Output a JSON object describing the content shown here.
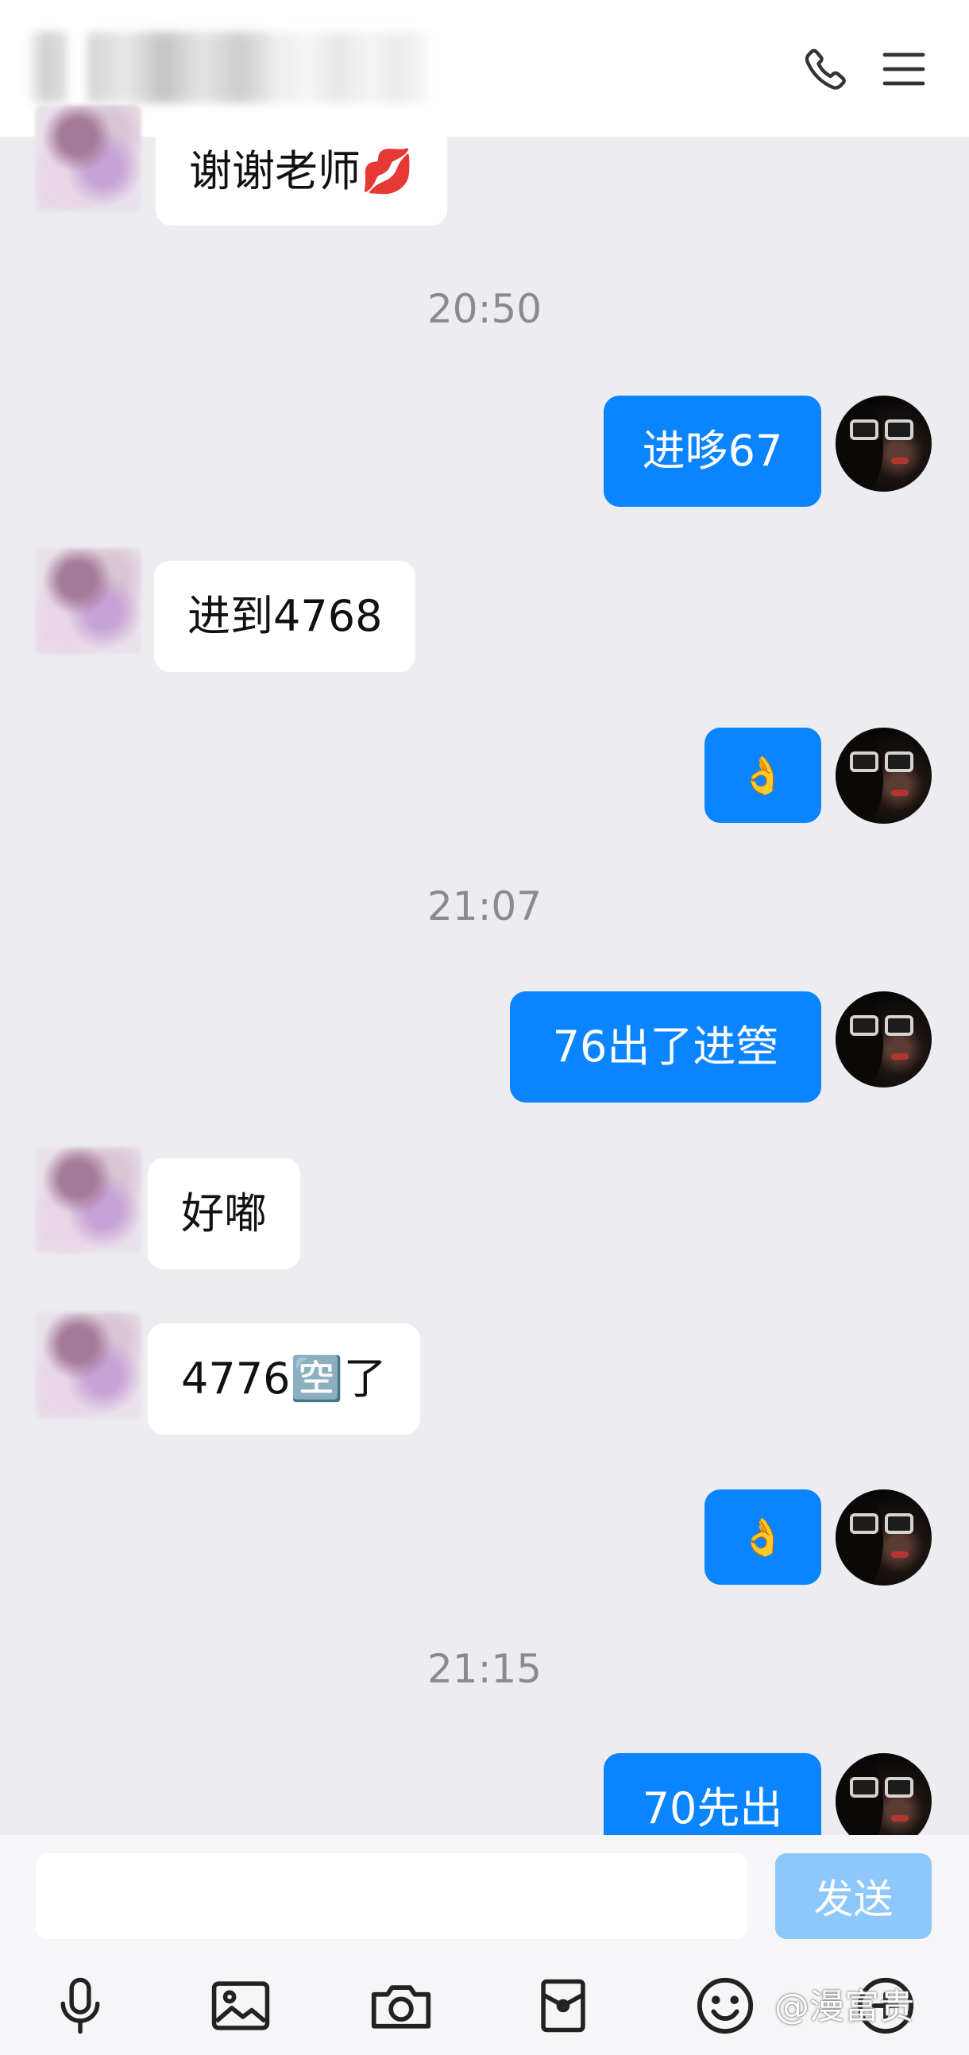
{
  "header": {
    "title_blurred": true,
    "call_icon": "phone-icon",
    "menu_icon": "menu-icon"
  },
  "messages": [
    {
      "side": "in",
      "text": "谢谢老师💋"
    },
    {
      "type": "time",
      "text": "20:50"
    },
    {
      "side": "out",
      "text": "进哆67"
    },
    {
      "side": "in",
      "text": "进到4768"
    },
    {
      "side": "out",
      "text": "👌"
    },
    {
      "type": "time",
      "text": "21:07"
    },
    {
      "side": "out",
      "text": "76出了进箜"
    },
    {
      "side": "in",
      "text": "好嘟"
    },
    {
      "side": "in",
      "text": "4776🈳了"
    },
    {
      "side": "out",
      "text": "👌"
    },
    {
      "type": "time",
      "text": "21:15"
    },
    {
      "side": "out",
      "text": "70先出"
    }
  ],
  "composer": {
    "input_value": "",
    "input_placeholder": "",
    "send_label": "发送"
  },
  "toolbar": {
    "icons": [
      "microphone-icon",
      "image-icon",
      "camera-icon",
      "red-packet-icon",
      "emoji-icon",
      "more-icon"
    ]
  },
  "watermark": "@漫富贵",
  "colors": {
    "background": "#ededf1",
    "outgoing_bubble": "#0a84ff",
    "incoming_bubble": "#ffffff",
    "send_button": "#8ec8fb",
    "timestamp": "#8a8a8f"
  }
}
